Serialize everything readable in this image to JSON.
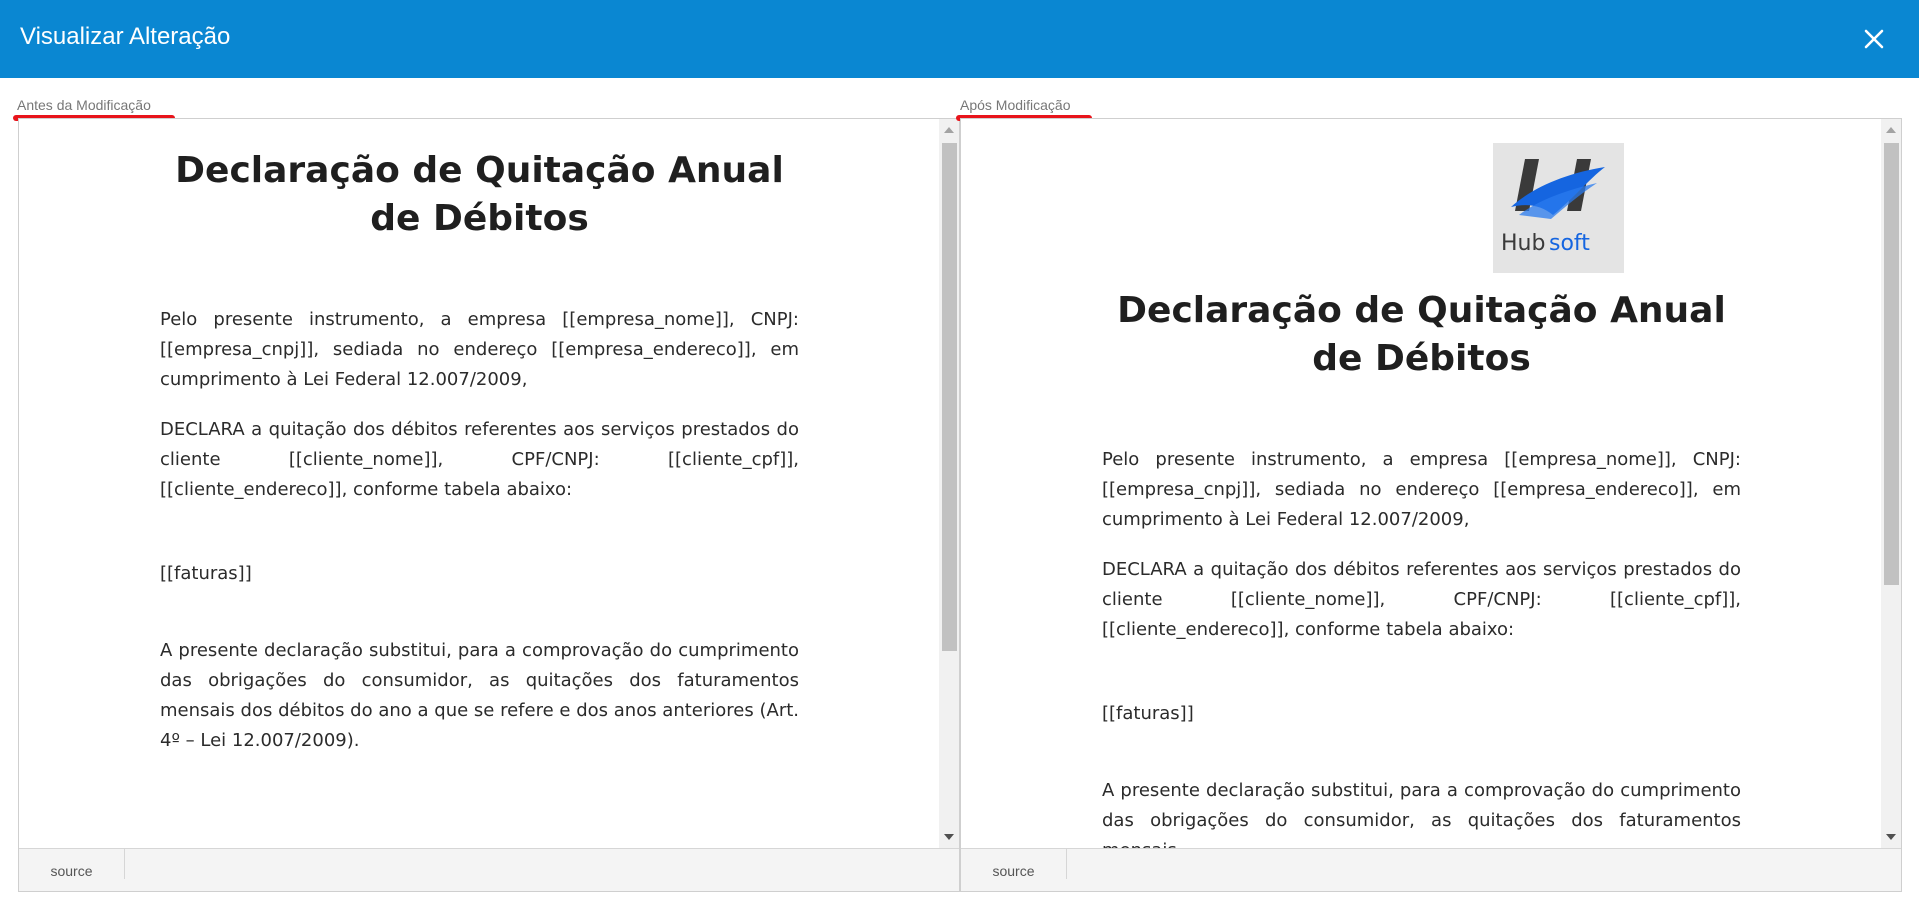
{
  "dialog": {
    "title": "Visualizar Alteração",
    "close_icon": "close-icon"
  },
  "before": {
    "label": "Antes da Modificação",
    "heading": "Declaração de Quitação Anual de Débitos",
    "paragraphs": [
      "Pelo presente instrumento, a empresa [[empresa_nome]], CNPJ: [[empresa_cnpj]], sediada no endereço [[empresa_endereco]], em cumprimento à Lei Federal 12.007/2009,",
      "DECLARA a quitação dos débitos referentes aos serviços prestados do cliente [[cliente_nome]], CPF/CNPJ: [[cliente_cpf]], [[cliente_endereco]], conforme tabela abaixo:",
      "[[faturas]]",
      "A presente declaração substitui, para a comprovação do cumprimento das obrigações do consumidor, as quitações dos faturamentos mensais dos débitos do ano a que se refere e dos anos anteriores (Art. 4º – Lei 12.007/2009)."
    ],
    "source_tab": "source"
  },
  "after": {
    "label": "Após Modificação",
    "logo_text_hub": "Hub",
    "logo_text_soft": "soft",
    "heading": "Declaração de Quitação Anual de Débitos",
    "paragraphs": [
      "Pelo presente instrumento, a empresa [[empresa_nome]], CNPJ: [[empresa_cnpj]], sediada no endereço [[empresa_endereco]], em cumprimento à Lei Federal 12.007/2009,",
      "DECLARA a quitação dos débitos referentes aos serviços prestados do cliente [[cliente_nome]], CPF/CNPJ: [[cliente_cpf]], [[cliente_endereco]], conforme tabela abaixo:",
      "[[faturas]]",
      "A presente declaração substitui, para a comprovação do cumprimento das obrigações do consumidor, as quitações dos faturamentos mensais"
    ],
    "source_tab": "source"
  },
  "colors": {
    "titlebar": "#0a87d2",
    "label_underline": "#e8141b",
    "logo_blue": "#1565e0",
    "logo_dark": "#3a3a3a"
  }
}
